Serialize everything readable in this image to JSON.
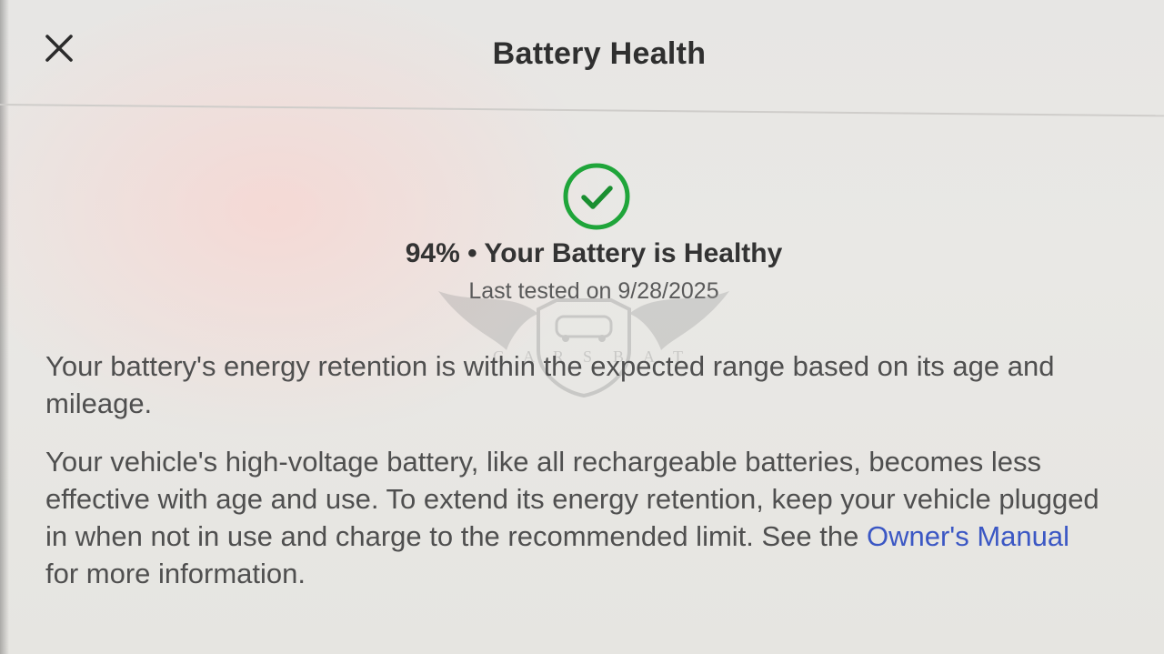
{
  "header": {
    "title": "Battery Health",
    "close_icon": "close-icon"
  },
  "status": {
    "icon": "check-circle-icon",
    "icon_color": "#1fa53a",
    "percent": "94%",
    "separator": "•",
    "message": "Your Battery is Healthy",
    "last_tested": "Last tested on 9/28/2025"
  },
  "watermark": {
    "letters": [
      "C",
      "A",
      "R",
      "S",
      "B",
      "A",
      "T"
    ]
  },
  "body": {
    "paragraph1": "Your battery's energy retention is within the expected range based on its age and mileage.",
    "paragraph2_before_link": "Your vehicle's high-voltage battery, like all rechargeable batteries, becomes less effective with age and use. To extend its energy retention, keep your vehicle plugged in when not in use and charge to the recommended limit. See the ",
    "link_text": "Owner's Manual",
    "paragraph2_after_link": " for more information.",
    "link_color": "#3b57c4"
  }
}
